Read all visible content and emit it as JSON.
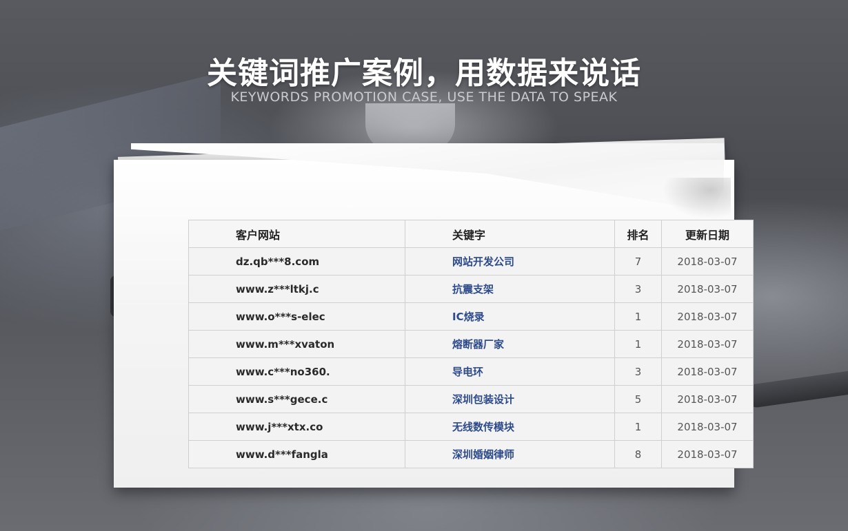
{
  "header": {
    "title": "关键词推广案例，用数据来说话",
    "subtitle": "KEYWORDS PROMOTION CASE, USE THE DATA TO SPEAK"
  },
  "table": {
    "columns": {
      "site": "客户网站",
      "keyword": "关键字",
      "rank": "排名",
      "date": "更新日期"
    },
    "rows": [
      {
        "site": "dz.qb***8.com",
        "keyword": "网站开发公司",
        "rank": "7",
        "date": "2018-03-07"
      },
      {
        "site": "www.z***ltkj.c",
        "keyword": "抗震支架",
        "rank": "3",
        "date": "2018-03-07"
      },
      {
        "site": "www.o***s-elec",
        "keyword": "IC烧录",
        "rank": "1",
        "date": "2018-03-07"
      },
      {
        "site": "www.m***xvaton",
        "keyword": "熔断器厂家",
        "rank": "1",
        "date": "2018-03-07"
      },
      {
        "site": "www.c***no360.",
        "keyword": "导电环",
        "rank": "3",
        "date": "2018-03-07"
      },
      {
        "site": "www.s***gece.c",
        "keyword": "深圳包装设计",
        "rank": "5",
        "date": "2018-03-07"
      },
      {
        "site": "www.j***xtx.co",
        "keyword": "无线数传模块",
        "rank": "1",
        "date": "2018-03-07"
      },
      {
        "site": "www.d***fangla",
        "keyword": "深圳婚姻律师",
        "rank": "8",
        "date": "2018-03-07"
      }
    ]
  },
  "colors": {
    "keyword_link": "#2d4a8a",
    "title": "#ffffff",
    "subtitle": "#c9cbd0"
  }
}
